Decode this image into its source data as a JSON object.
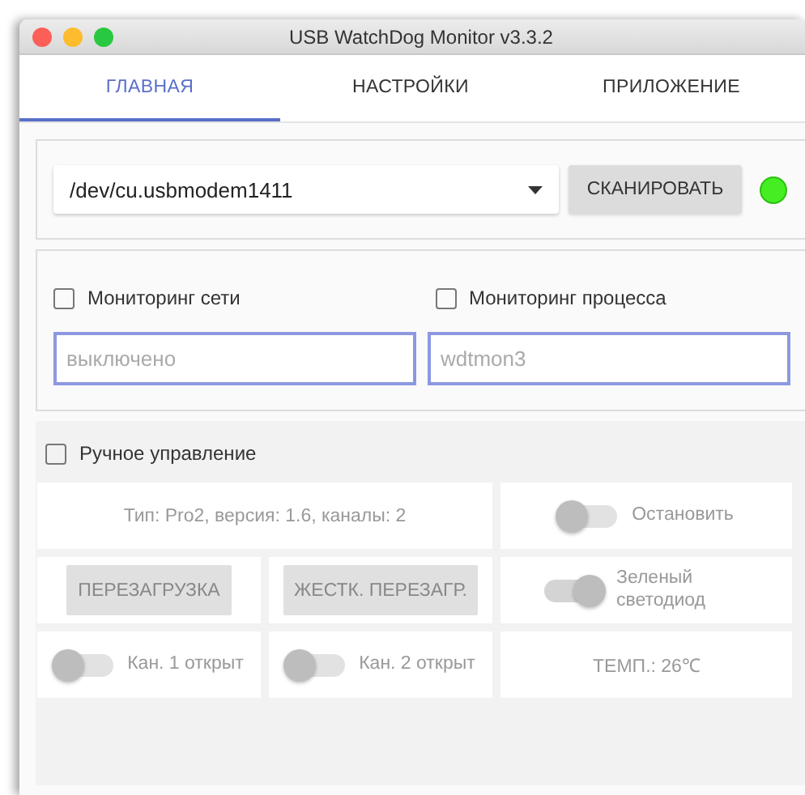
{
  "window": {
    "title": "USB WatchDog Monitor v3.3.2"
  },
  "tabs": [
    {
      "label": "ГЛАВНАЯ",
      "selected": true
    },
    {
      "label": "НАСТРОЙКИ",
      "selected": false
    },
    {
      "label": "ПРИЛОЖЕНИЕ",
      "selected": false
    }
  ],
  "port": {
    "value": "/dev/cu.usbmodem1411",
    "scan_button": "СКАНИРОВАТЬ",
    "connected": true
  },
  "monitoring": {
    "checkboxes": [
      {
        "label": "Мониторинг сети",
        "checked": false
      },
      {
        "label": "Мониторинг процесса",
        "checked": false
      }
    ],
    "fields": [
      {
        "placeholder": "выключено"
      },
      {
        "placeholder": "wdtmon3"
      }
    ]
  },
  "manual": {
    "label": "Ручное управление",
    "checked": false,
    "cells": [
      {
        "kind": "info",
        "text": "Тип: Pro2, версия: 1.6, каналы: 2"
      },
      {
        "kind": "toggle",
        "label": "Остановить",
        "on": false
      },
      {
        "kind": "button",
        "label": "ПЕРЕЗАГРУЗКА"
      },
      {
        "kind": "button",
        "label": "ЖЕСТК. ПЕРЕЗАГР."
      },
      {
        "kind": "toggle",
        "label": "Зеленый светодиод",
        "on": true
      },
      {
        "kind": "toggle",
        "label": "Кан. 1 открыт",
        "on": false
      },
      {
        "kind": "toggle",
        "label": "Кан. 2 открыт",
        "on": false
      },
      {
        "kind": "info",
        "text": "ТЕМП.: 26℃"
      }
    ]
  }
}
